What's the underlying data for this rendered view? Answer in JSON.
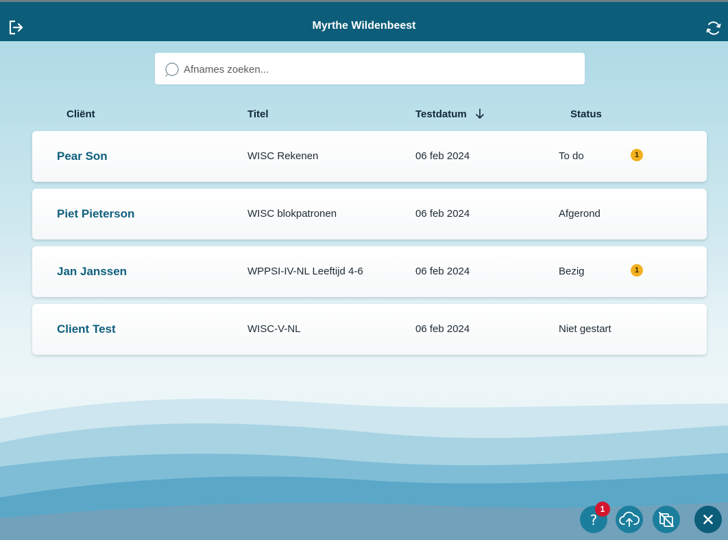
{
  "header": {
    "title": "Myrthe Wildenbeest",
    "logout_icon": "logout-icon",
    "sync_icon": "sync-icon"
  },
  "search": {
    "placeholder": "Afnames zoeken...",
    "value": ""
  },
  "table": {
    "columns": {
      "client": "Cliënt",
      "title": "Titel",
      "date": "Testdatum",
      "status": "Status"
    },
    "sort": {
      "column": "date",
      "direction": "descending"
    },
    "rows": [
      {
        "client": "Pear Son",
        "title": "WISC Rekenen",
        "date": "06 feb 2024",
        "status": "To do",
        "badge": "1"
      },
      {
        "client": "Piet Pieterson",
        "title": "WISC blokpatronen",
        "date": "06 feb 2024",
        "status": "Afgerond",
        "badge": null
      },
      {
        "client": "Jan Janssen",
        "title": "WPPSI-IV-NL Leeftijd 4-6",
        "date": "06 feb 2024",
        "status": "Bezig",
        "badge": "1"
      },
      {
        "client": "Client Test",
        "title": "WISC-V-NL",
        "date": "06 feb 2024",
        "status": "Niet gestart",
        "badge": null
      }
    ]
  },
  "actions": {
    "help": {
      "icon": "help-icon",
      "label": "?",
      "notification_count": "1"
    },
    "upload": {
      "icon": "cloud-upload-icon"
    },
    "no_sync": {
      "icon": "sync-disabled-icon"
    },
    "close": {
      "icon": "close-icon"
    }
  },
  "colors": {
    "header_bg": "#0b5d79",
    "client_name": "#0f5f7e",
    "badge": "#f3b11f",
    "notification": "#d3162e",
    "action_button": "#1b7e9c"
  }
}
